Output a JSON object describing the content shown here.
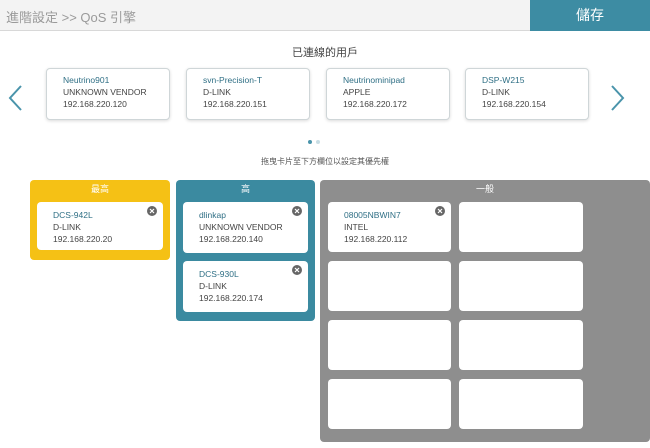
{
  "header": {
    "breadcrumb": "進階設定 >> QoS 引擎",
    "save_label": "儲存"
  },
  "connected": {
    "title": "已連線的用戶",
    "devices": [
      {
        "name": "Neutrino901",
        "vendor": "UNKNOWN VENDOR",
        "ip": "192.168.220.120"
      },
      {
        "name": "svn-Precision-T",
        "vendor": "D-LINK",
        "ip": "192.168.220.151"
      },
      {
        "name": "Neutrinominipad",
        "vendor": "APPLE",
        "ip": "192.168.220.172"
      },
      {
        "name": "DSP-W215",
        "vendor": "D-LINK",
        "ip": "192.168.220.154"
      }
    ]
  },
  "instruction": "拖曳卡片至下方欄位以設定其優先權",
  "priority": {
    "highest": {
      "label": "最高",
      "devices": [
        {
          "name": "DCS-942L",
          "vendor": "D-LINK",
          "ip": "192.168.220.20"
        }
      ]
    },
    "high": {
      "label": "高",
      "devices": [
        {
          "name": "dlinkap",
          "vendor": "UNKNOWN VENDOR",
          "ip": "192.168.220.140"
        },
        {
          "name": "DCS-930L",
          "vendor": "D-LINK",
          "ip": "192.168.220.174"
        }
      ]
    },
    "normal": {
      "label": "一般",
      "devices": [
        {
          "name": "08005NBWIN7",
          "vendor": "INTEL",
          "ip": "192.168.220.112"
        }
      ]
    }
  },
  "colors": {
    "save_button": "#3d8ca3",
    "highest_panel": "#f5c115",
    "high_panel": "#3b8aa0",
    "normal_panel": "#8e8e8e"
  }
}
